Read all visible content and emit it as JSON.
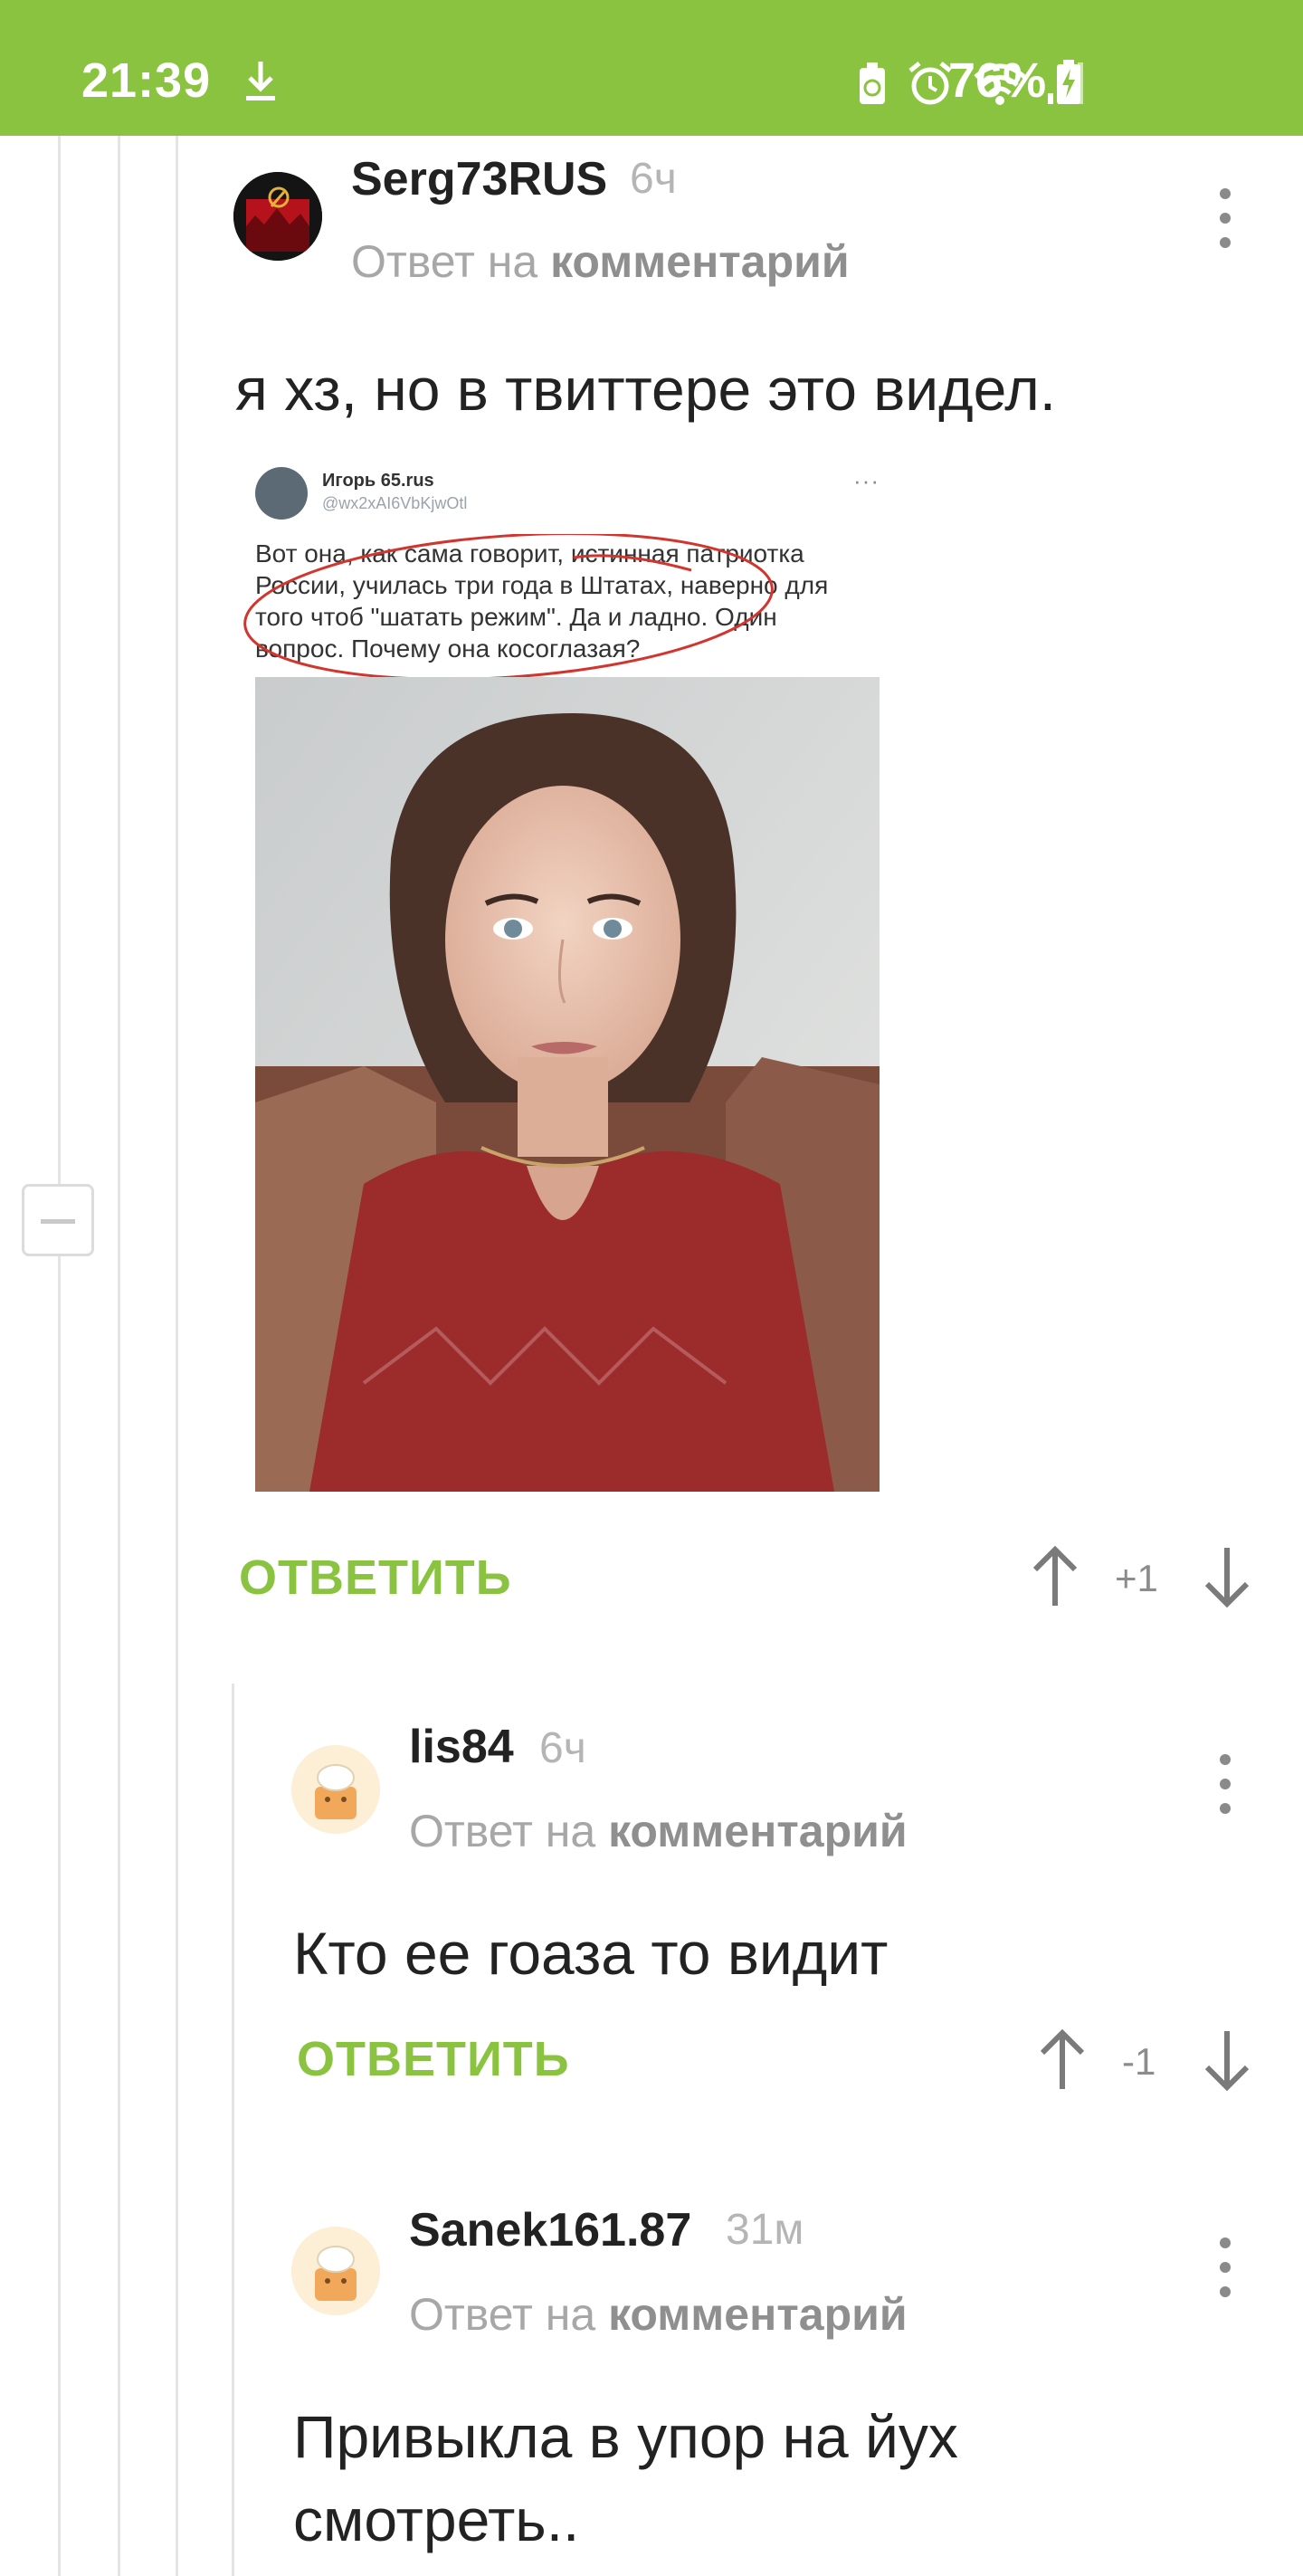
{
  "status_bar": {
    "time": "21:39",
    "battery_percent": "76%",
    "icons": [
      "download-icon",
      "recycle-icon",
      "alarm-icon",
      "wifi-icon",
      "signal-icon",
      "battery-charging-icon"
    ]
  },
  "colors": {
    "brand_green": "#8ac33f",
    "thread_line": "#e4e4e4"
  },
  "comments": [
    {
      "author": "Serg73RUS",
      "time": "6ч",
      "reply_prefix": "Ответ на",
      "reply_link": "комментарий",
      "text": "я хз, но в твиттере это видел.",
      "reply_label": "ОТВЕТИТЬ",
      "score": "+1",
      "attached_image": {
        "tweet_author": "Игорь 65.rus",
        "tweet_handle": "@wx2xAI6VbKjwOtl",
        "tweet_text": "Вот она, как сама говорит, истинная патриотка России, училась три года в Штатах, наверно для того чтоб \"шатать режим\". Да и ладно. Один вопрос. Почему она косоглазая?"
      }
    },
    {
      "author": "lis84",
      "time": "6ч",
      "reply_prefix": "Ответ на",
      "reply_link": "комментарий",
      "text": "Кто ее гоаза то видит",
      "reply_label": "ОТВЕТИТЬ",
      "score": "-1"
    },
    {
      "author": "Sanek161.87",
      "time": "31м",
      "reply_prefix": "Ответ на",
      "reply_link": "комментарий",
      "text": "Привыкла в упор на йух смотреть.."
    }
  ]
}
